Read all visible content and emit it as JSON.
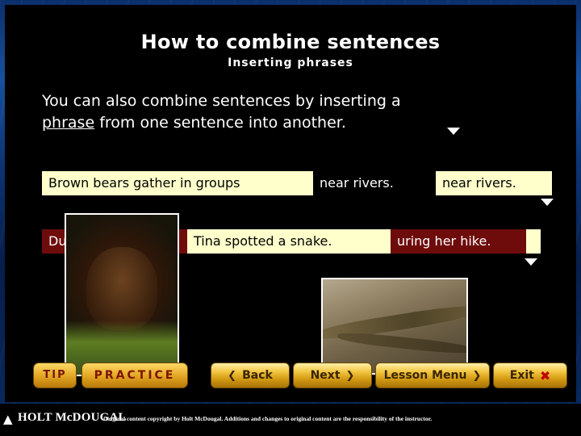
{
  "slide": {
    "title": "How to combine sentences",
    "subtitle": "Inserting phrases",
    "body_line1": "You can also combine sentences by inserting a",
    "body_underlined": "phrase",
    "body_line2_rest": " from one sentence into another."
  },
  "example1": {
    "part_a": "Brown bears gather in groups",
    "part_b": "near rivers.",
    "part_c": "near rivers."
  },
  "example2": {
    "part_a": "During her hike",
    "part_b": "Tina spotted a snake.",
    "part_c": "uring her hike."
  },
  "images": [
    {
      "name": "brown-bear-photo",
      "alt": "Brown bear standing in tall grass"
    },
    {
      "name": "snake-photo",
      "alt": "Brown snake on rocky ground"
    }
  ],
  "buttons": {
    "tip": "TIP",
    "practice": "PRACTICE",
    "back": "Back",
    "next": "Next",
    "lesson_menu": "Lesson Menu",
    "exit": "Exit"
  },
  "icons": {
    "back_chevron": "❮",
    "next_chevron": "❯",
    "lesson_menu_chevron": "❯",
    "exit_x": "✖"
  },
  "footer": {
    "logo_text": "HOLT Mc Dougal",
    "logo_line1": "HOLT",
    "logo_line2": "McDOUGAL",
    "copyright": "Original content copyright by Holt McDougal. Additions and changes to original content are the responsibility of the instructor."
  },
  "colors": {
    "highlight_cream": "#ffffcc",
    "highlight_maroon": "#6e0b0b",
    "button_gold": "#e0a320",
    "slide_blue": "#17509e"
  }
}
